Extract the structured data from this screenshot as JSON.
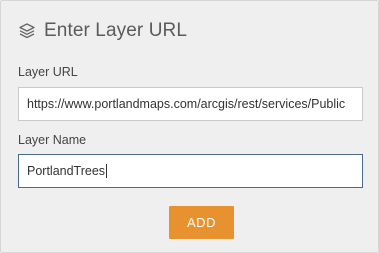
{
  "header": {
    "icon": "layers-icon",
    "title": "Enter Layer URL"
  },
  "layer_url": {
    "label": "Layer URL",
    "value": "https://www.portlandmaps.com/arcgis/rest/services/Public"
  },
  "layer_name": {
    "label": "Layer Name",
    "value": "PortlandTrees"
  },
  "add_button": {
    "label": "ADD",
    "color": "#e8922f"
  }
}
